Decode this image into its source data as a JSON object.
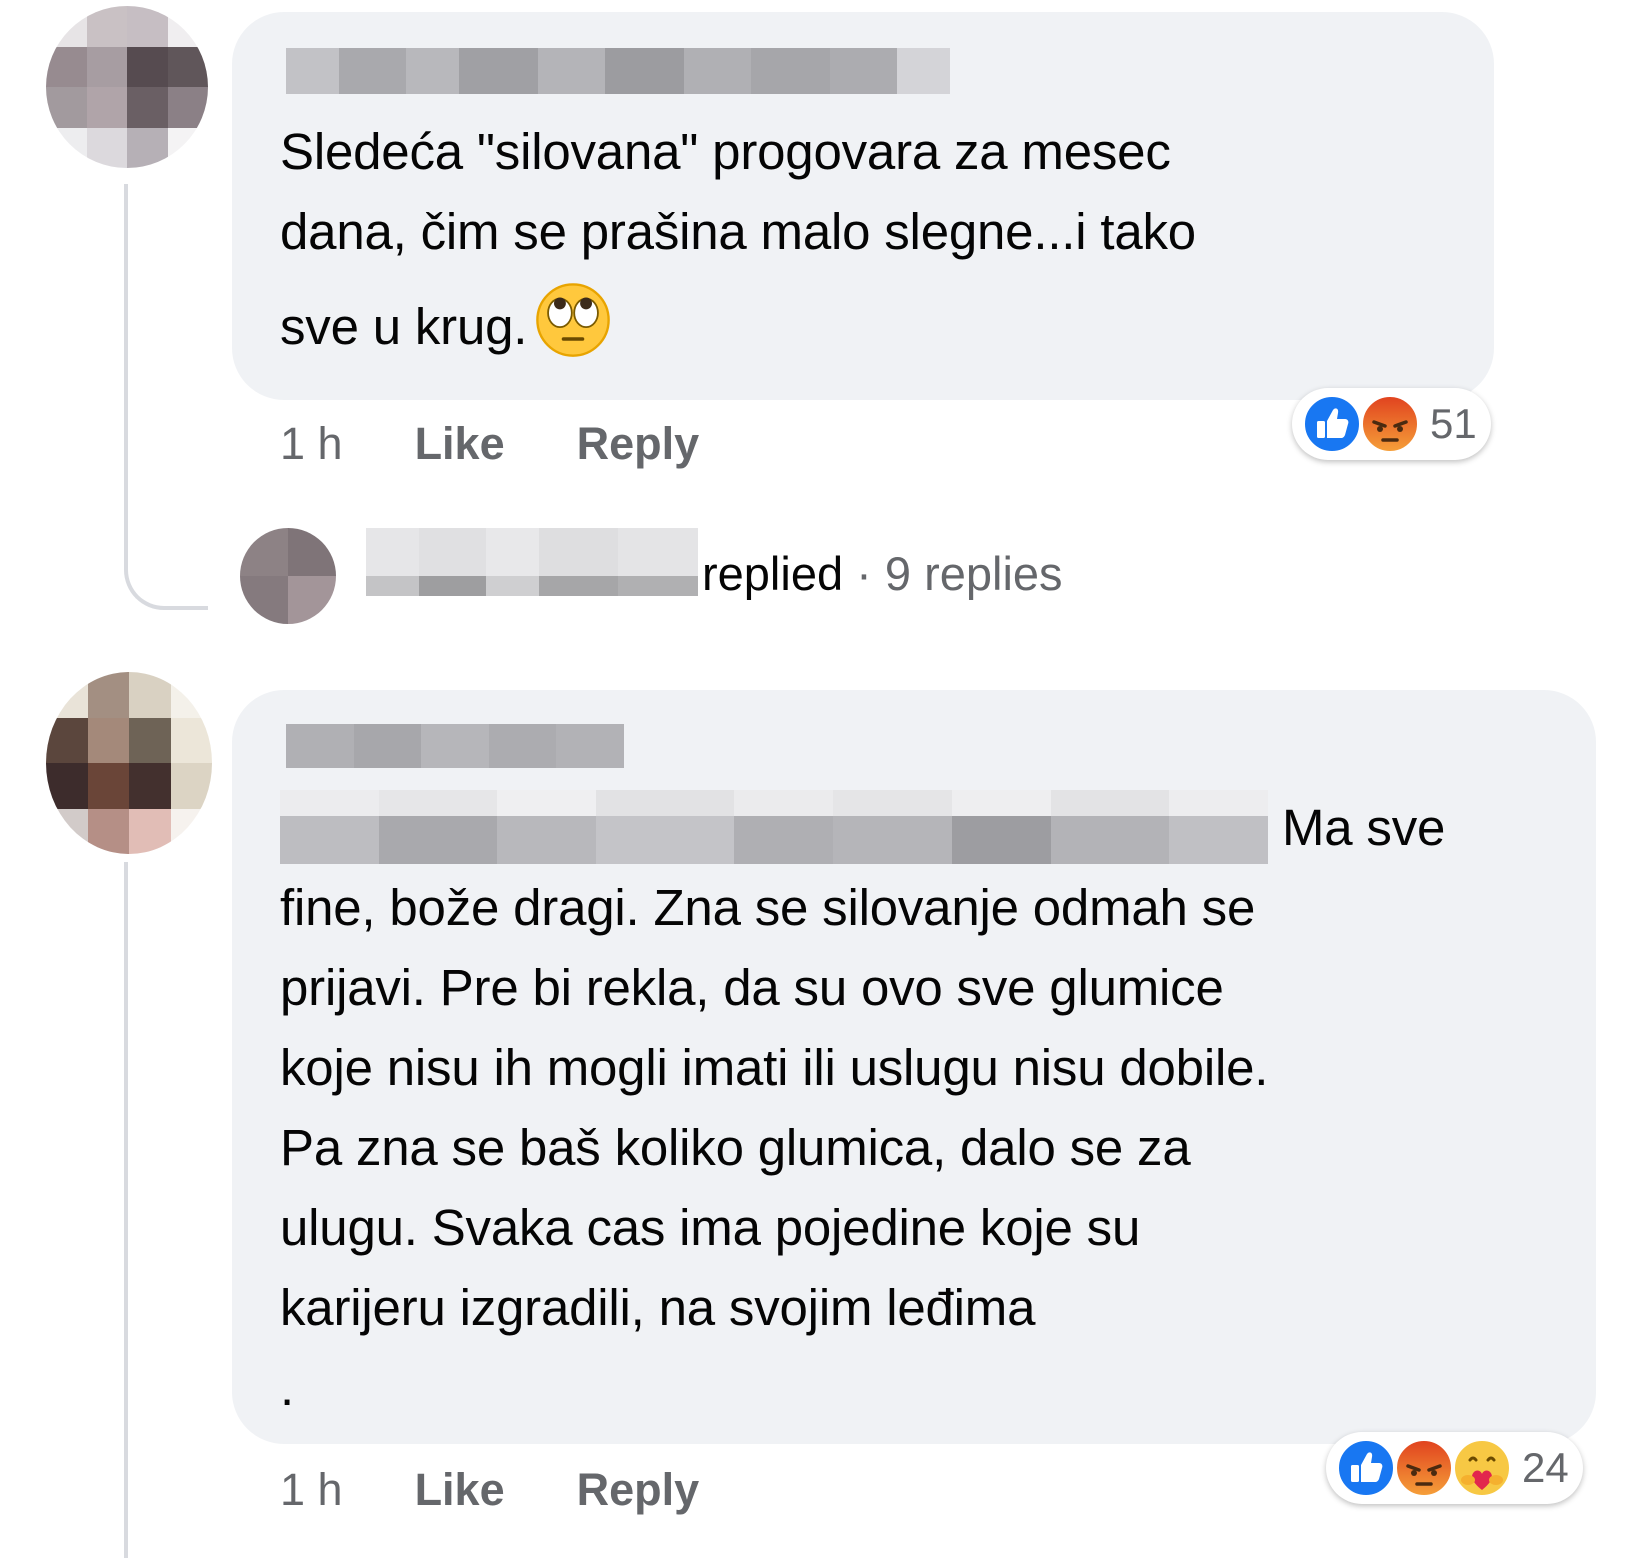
{
  "comments": [
    {
      "author": "",
      "text_lines": [
        "Sledeća \"silovana\" progovara za mesec",
        "dana, čim se prašina malo slegne...i tako",
        "sve u krug."
      ],
      "emoji": "face-with-rolling-eyes-icon",
      "time": "1 h",
      "like_label": "Like",
      "reply_label": "Reply",
      "reactions": [
        "like-reaction-icon",
        "angry-reaction-icon"
      ],
      "reaction_count": "51"
    },
    {
      "author": "",
      "text_lines": [
        "Ma sve",
        "fine, bože dragi. Zna se silovanje odmah se",
        "prijavi. Pre bi rekla, da su ovo sve glumice",
        "koje nisu ih mogli imati ili uslugu nisu dobile.",
        "Pa zna se baš koliko glumica, dalo se za",
        "ulugu. Svaka cas ima pojedine koje su",
        "karijeru izgradili, na svojim leđima",
        "."
      ],
      "time": "1 h",
      "like_label": "Like",
      "reply_label": "Reply",
      "reactions": [
        "like-reaction-icon",
        "angry-reaction-icon",
        "care-reaction-icon"
      ],
      "reaction_count": "24"
    }
  ],
  "reply_summary": {
    "verb": "replied",
    "separator": "·",
    "count_label": "9 replies"
  },
  "colors": {
    "bubble": "#f0f2f5",
    "secondary_text": "#65676b",
    "like_blue": "#1877f2",
    "angry_orange": "#f0542a"
  }
}
